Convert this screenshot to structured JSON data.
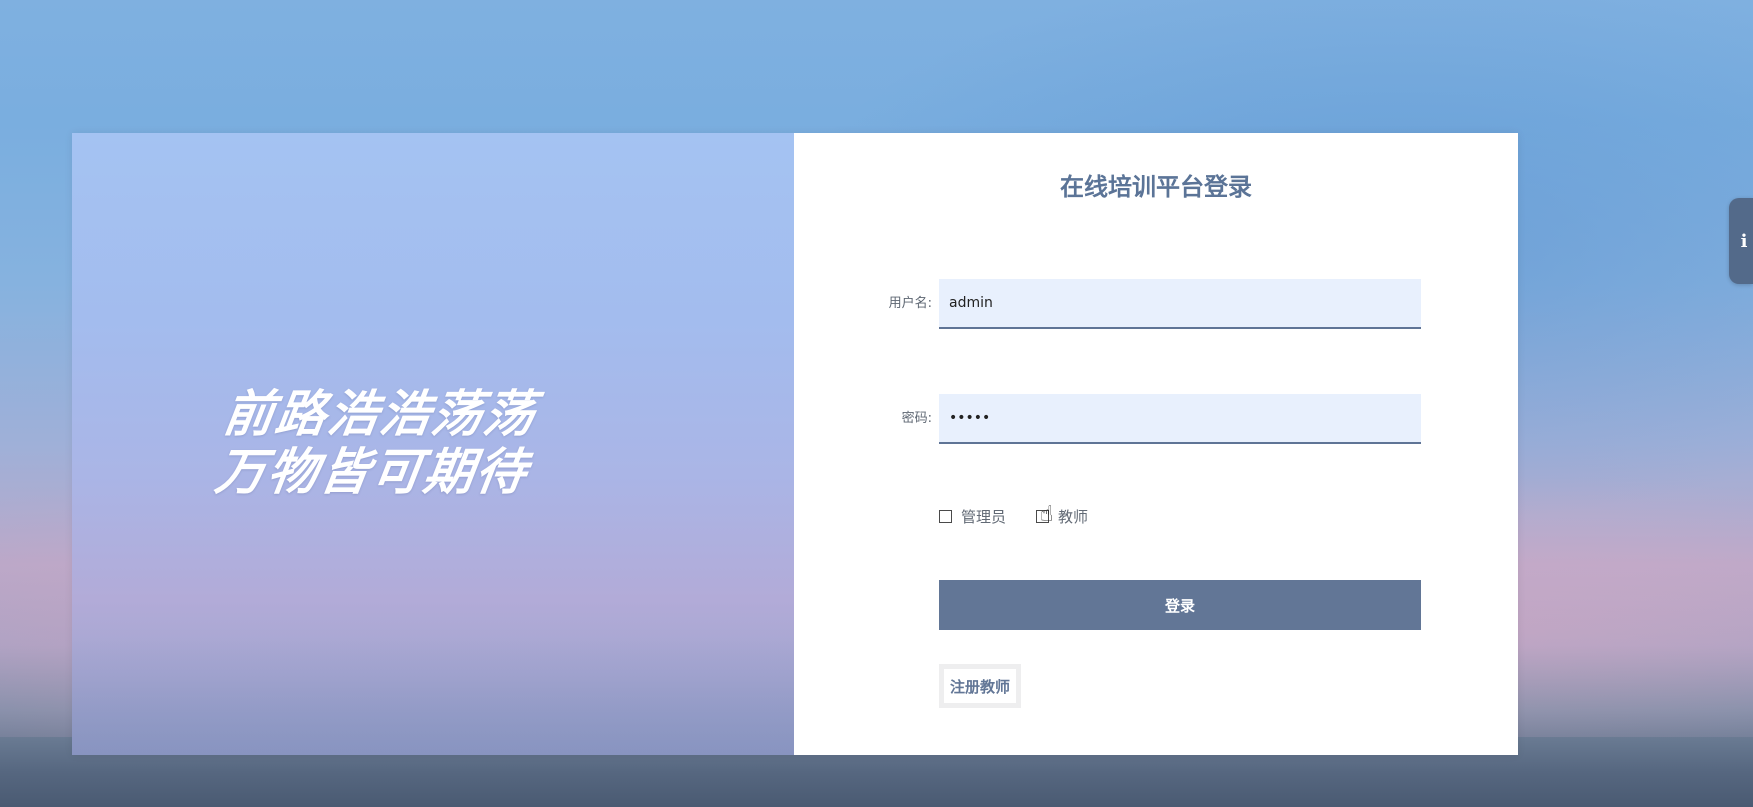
{
  "slogan": {
    "line1": "前路浩浩荡荡",
    "line2": "万物皆可期待"
  },
  "form": {
    "title": "在线培训平台登录",
    "username_label": "用户名:",
    "username_value": "admin",
    "password_label": "密码:",
    "password_value": "•••••",
    "roles": [
      {
        "label": "管理员",
        "checked": false
      },
      {
        "label": "教师",
        "checked": false
      }
    ],
    "login_label": "登录",
    "register_label": "注册教师"
  },
  "side_tab": {
    "icon": "info-icon",
    "glyph": "i"
  },
  "colors": {
    "accent": "#627696",
    "title": "#5b7497",
    "input_bg": "#e8f0fd"
  }
}
